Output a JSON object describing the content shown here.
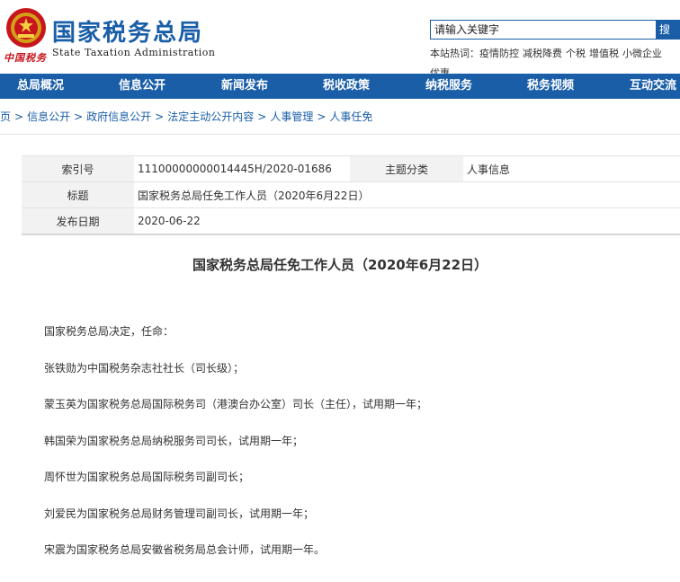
{
  "header": {
    "title": "国家税务总局",
    "subtitle": "State Taxation Administration",
    "logo_script": "中国税务",
    "search_placeholder": "请输入关键字",
    "search_button": "搜",
    "hot_label": "本站热词：",
    "hot_words": [
      "疫情防控",
      "减税降费",
      "个税",
      "增值税",
      "小微企业"
    ],
    "hot_overflow": "优惠"
  },
  "nav": [
    "总局概况",
    "信息公开",
    "新闻发布",
    "税收政策",
    "纳税服务",
    "税务视频",
    "互动交流"
  ],
  "breadcrumb": [
    "首页",
    "信息公开",
    "政府信息公开",
    "法定主动公开内容",
    "人事管理",
    "人事任免"
  ],
  "meta": {
    "index_label": "索引号",
    "index_value": "11100000000014445H/2020-01686",
    "category_label": "主题分类",
    "category_value": "人事信息",
    "title_label": "标题",
    "title_value": "国家税务总局任免工作人员（2020年6月22日）",
    "date_label": "发布日期",
    "date_value": "2020-06-22"
  },
  "article": {
    "title": "国家税务总局任免工作人员（2020年6月22日）",
    "paragraphs": [
      "国家税务总局决定，任命：",
      "张铁勋为中国税务杂志社社长（司长级）；",
      "蒙玉英为国家税务总局国际税务司（港澳台办公室）司长（主任），试用期一年；",
      "韩国荣为国家税务总局纳税服务司司长，试用期一年；",
      "周怀世为国家税务总局国际税务司副司长；",
      "刘爱民为国家税务总局财务管理司副司长，试用期一年；",
      "宋震为国家税务总局安徽省税务局总会计师，试用期一年。"
    ]
  },
  "colors": {
    "brand_blue": "#1a5ea8",
    "logo_red": "#c8161d"
  }
}
